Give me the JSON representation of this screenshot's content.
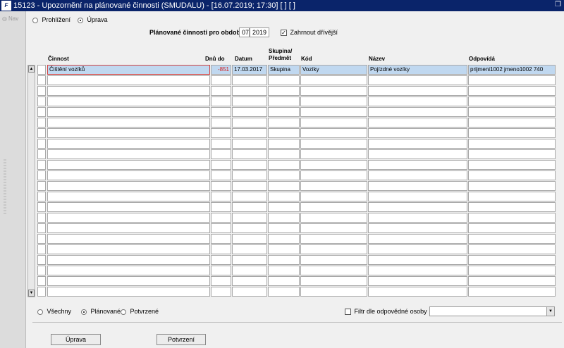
{
  "window": {
    "title": "15123 - Upozornění na plánované činnosti (SMUDALU) - [16.07.2019; 17:30]  [ ]  [ ]",
    "app_icon": "F"
  },
  "nav": {
    "label": "Nav"
  },
  "mode": {
    "options": [
      "Prohlížení",
      "Úprava"
    ],
    "selected": "Úprava"
  },
  "period": {
    "label": "Plánované činnosti pro období",
    "month": "07",
    "year": "2019",
    "include_earlier_label": "Zahrnout dřívější",
    "include_earlier_checked": true
  },
  "table": {
    "headers": {
      "cinnost": "Činnost",
      "dnu_do": "Dnů do",
      "datum": "Datum",
      "skupina_line1": "Skupina/",
      "skupina_line2": "Předmět",
      "kod": "Kód",
      "nazev": "Název",
      "odpovida": "Odpovídá"
    },
    "rows": [
      {
        "cinnost": "Čištění vozíků",
        "dnu_do": "-851",
        "datum": "17.03.2017",
        "skupina": "Skupina",
        "kod": "Vozíky",
        "nazev": "Pojízdné vozíky",
        "odpovida": "prijmeni1002 jmeno1002 740"
      }
    ]
  },
  "filter": {
    "options": [
      "Všechny",
      "Plánované",
      "Potvrzené"
    ],
    "selected": "Plánované",
    "responsible_filter_label": "Filtr dle odpovědné osoby",
    "responsible_filter_checked": false,
    "responsible_value": ""
  },
  "buttons": {
    "edit": "Úprava",
    "confirm": "Potvrzení"
  }
}
